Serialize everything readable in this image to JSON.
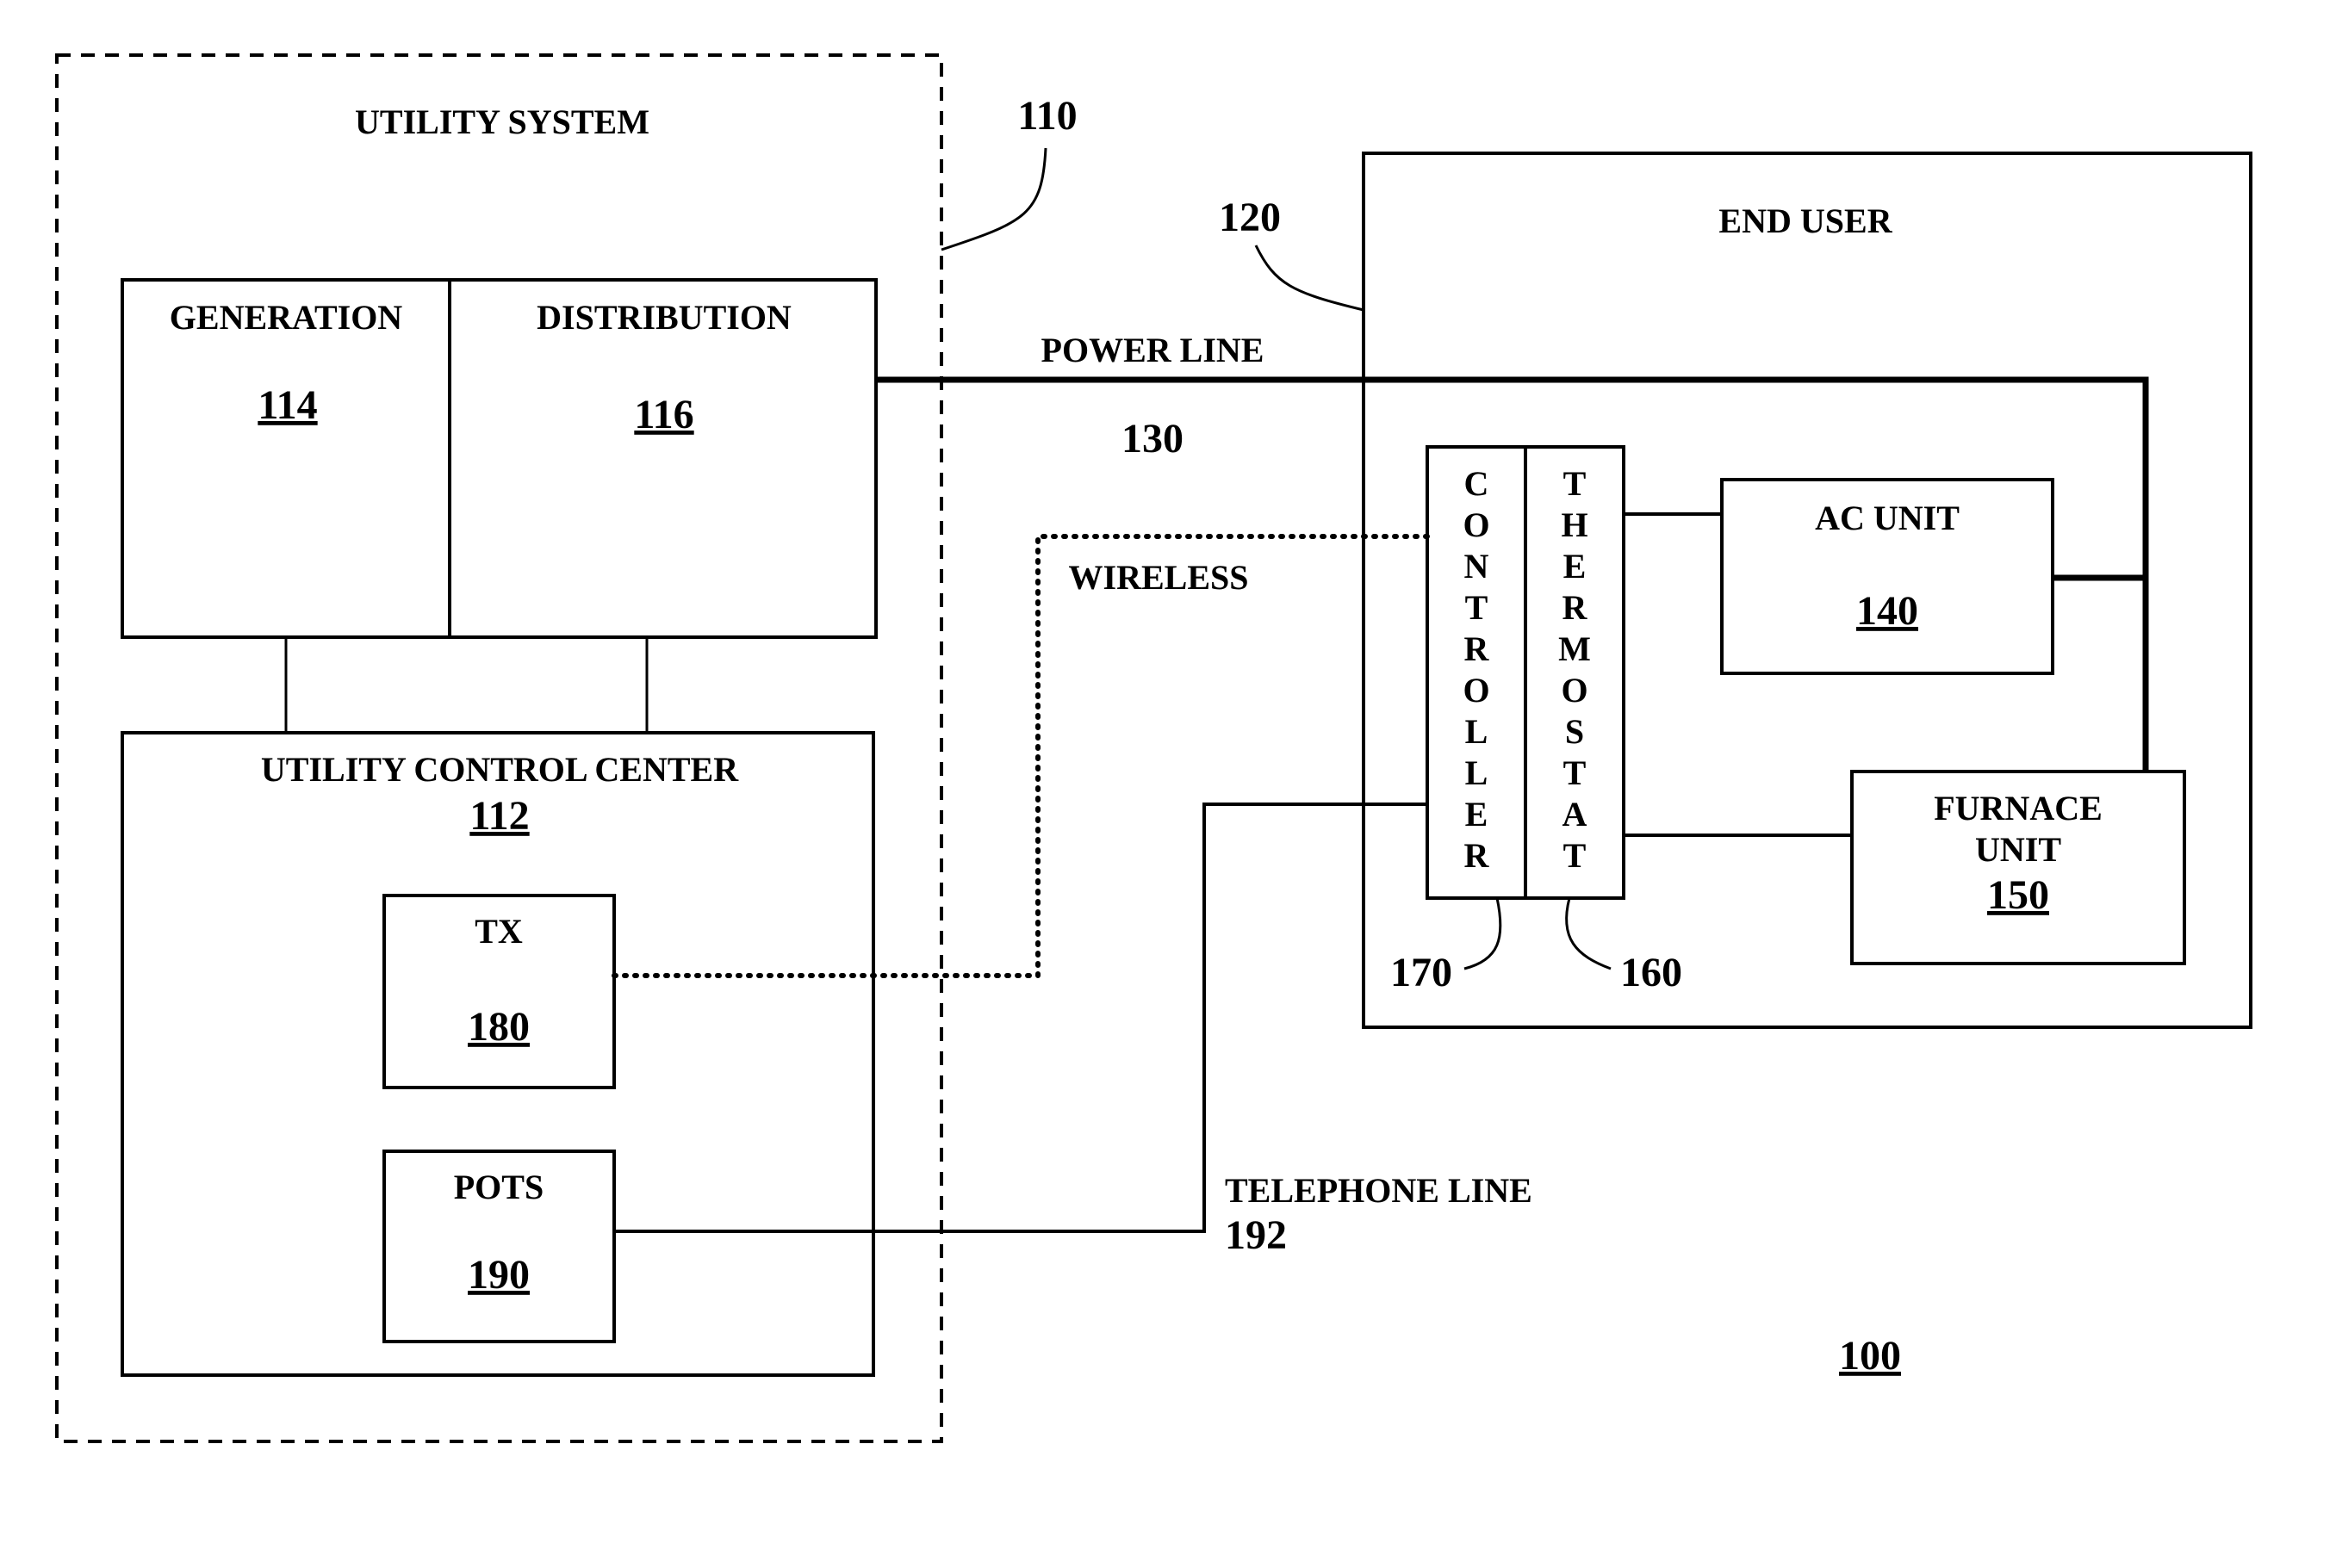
{
  "figure_number": "100",
  "utility_system": {
    "title": "UTILITY SYSTEM",
    "ref": "110"
  },
  "generation": {
    "title": "GENERATION",
    "ref": "114"
  },
  "distribution": {
    "title": "DISTRIBUTION",
    "ref": "116"
  },
  "control_center": {
    "title": "UTILITY CONTROL CENTER",
    "ref": "112"
  },
  "tx": {
    "title": "TX",
    "ref": "180"
  },
  "pots": {
    "title": "POTS",
    "ref": "190"
  },
  "power_line": {
    "title": "POWER LINE",
    "ref": "130"
  },
  "wireless": {
    "title": "WIRELESS"
  },
  "telephone_line": {
    "title": "TELEPHONE LINE",
    "ref": "192"
  },
  "end_user": {
    "title": "END USER",
    "ref": "120"
  },
  "controller": {
    "letters": [
      "C",
      "O",
      "N",
      "T",
      "R",
      "O",
      "L",
      "L",
      "E",
      "R"
    ],
    "ref": "170"
  },
  "thermostat": {
    "letters": [
      "T",
      "H",
      "E",
      "R",
      "M",
      "O",
      "S",
      "T",
      "A",
      "T"
    ],
    "ref": "160"
  },
  "ac_unit": {
    "title": "AC UNIT",
    "ref": "140"
  },
  "furnace_unit": {
    "title_line1": "FURNACE",
    "title_line2": "UNIT",
    "ref": "150"
  }
}
